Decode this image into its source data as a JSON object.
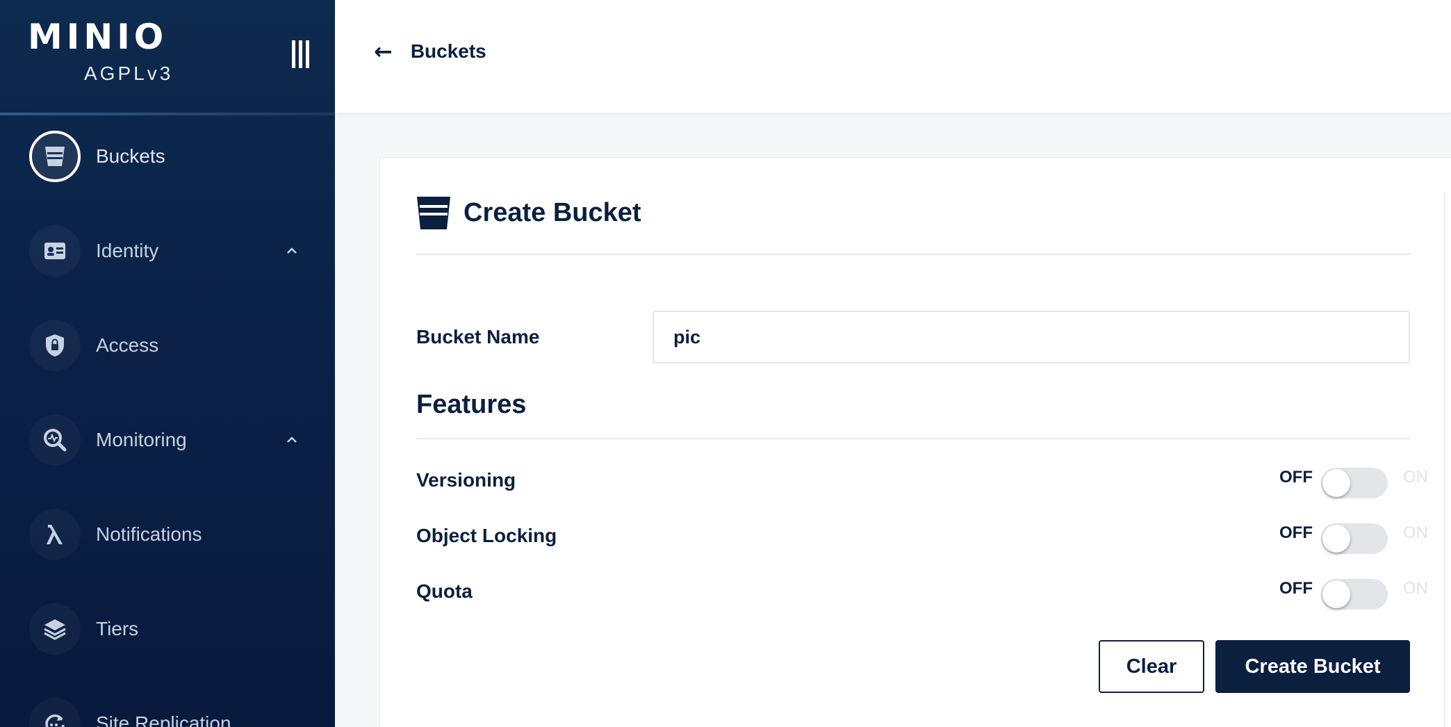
{
  "brand": {
    "logo": "MINIO",
    "license": "AGPLv3"
  },
  "sidebar": {
    "items": [
      {
        "label": "Buckets",
        "icon": "bucket-icon",
        "active": true
      },
      {
        "label": "Identity",
        "icon": "id-card-icon",
        "expanded": true
      },
      {
        "label": "Access",
        "icon": "shield-lock-icon"
      },
      {
        "label": "Monitoring",
        "icon": "monitor-search-icon",
        "expanded": true
      },
      {
        "label": "Notifications",
        "icon": "lambda-icon"
      },
      {
        "label": "Tiers",
        "icon": "layers-icon"
      },
      {
        "label": "Site Replication",
        "icon": "replication-icon"
      }
    ]
  },
  "topbar": {
    "back_label": "Buckets"
  },
  "create_bucket": {
    "title": "Create Bucket",
    "bucket_name_label": "Bucket Name",
    "bucket_name_value": "pic",
    "features_title": "Features",
    "features": [
      {
        "label": "Versioning",
        "off_label": "OFF",
        "on_label": "ON",
        "state": "off"
      },
      {
        "label": "Object Locking",
        "off_label": "OFF",
        "on_label": "ON",
        "state": "off"
      },
      {
        "label": "Quota",
        "off_label": "OFF",
        "on_label": "ON",
        "state": "off"
      }
    ],
    "clear_label": "Clear",
    "create_label": "Create Bucket"
  },
  "colors": {
    "sidebar_bg": "#0b2147",
    "primary": "#0b1f3f",
    "toggle_off": "#e3e5e8"
  }
}
